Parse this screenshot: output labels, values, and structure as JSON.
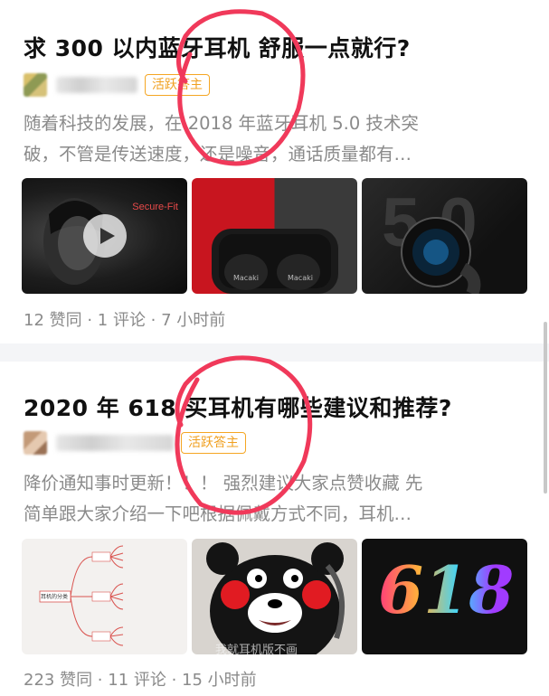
{
  "answers": [
    {
      "title": "求 300 以内蓝牙耳机  舒服一点就行?",
      "badge": "活跃答主",
      "excerpt_line1": "随着科技的发展，在 2018 年蓝牙耳机 5.0 技术突",
      "excerpt_line2": "破，不管是传送速度，还是噪音，通话质量都有…",
      "thumb1_text": "Secure-Fit",
      "thumb2_text_left": "Macaki",
      "thumb2_text_right": "Macaki",
      "thumb3_text": "5.0",
      "meta": "12 赞同 · 1 评论 · 7 小时前"
    },
    {
      "title": "2020 年 618 买耳机有哪些建议和推荐?",
      "badge": "活跃答主",
      "excerpt_line1": "降价通知事时更新！！！ 强烈建议大家点赞收藏 先",
      "excerpt_line2": "简单跟大家介绍一下吧根据佩戴方式不同，耳机…",
      "thumb1_text": "耳机的分类",
      "thumb2_text": "我就耳机版不画",
      "thumb3_text": "618",
      "meta": "223 赞同 · 11 评论 · 15 小时前"
    }
  ],
  "colors": {
    "badge": "#f0a020",
    "annotation": "#f0395a",
    "text_secondary": "#8a8a8a"
  }
}
